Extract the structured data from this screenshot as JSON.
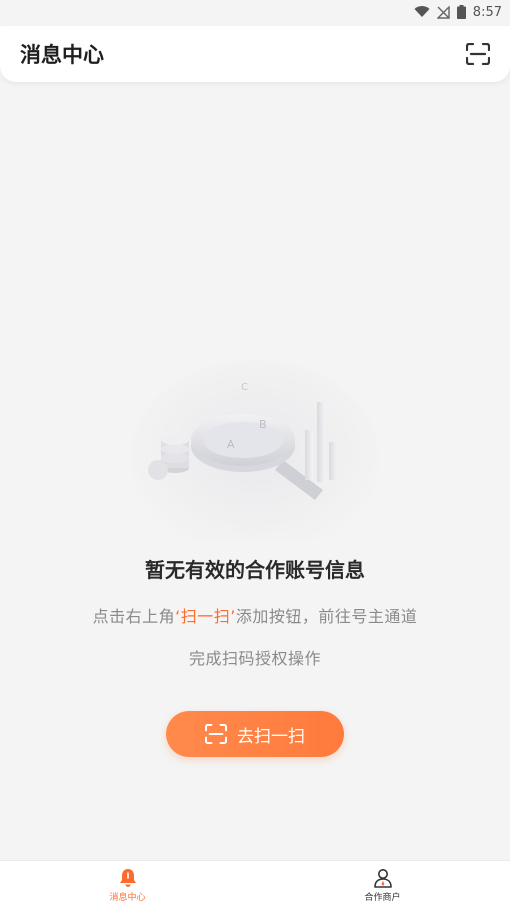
{
  "status": {
    "time": "8:57"
  },
  "header": {
    "title": "消息中心",
    "scan_icon": "scan-icon"
  },
  "empty_state": {
    "illustration": "search-magnifier-illustration",
    "title": "暂无有效的合作账号信息",
    "desc1_prefix": "点击右上角",
    "desc1_highlight": "‘扫一扫’",
    "desc1_suffix": "添加按钮，前往号主通道",
    "desc2": "完成扫码授权操作",
    "button_label": "去扫一扫"
  },
  "tabbar": {
    "items": [
      {
        "label": "消息中心",
        "icon": "bell-icon",
        "active": true
      },
      {
        "label": "合作商户",
        "icon": "merchant-person-icon",
        "active": false
      }
    ]
  },
  "colors": {
    "accent": "#ff7a3d",
    "background": "#f4f4f4"
  }
}
